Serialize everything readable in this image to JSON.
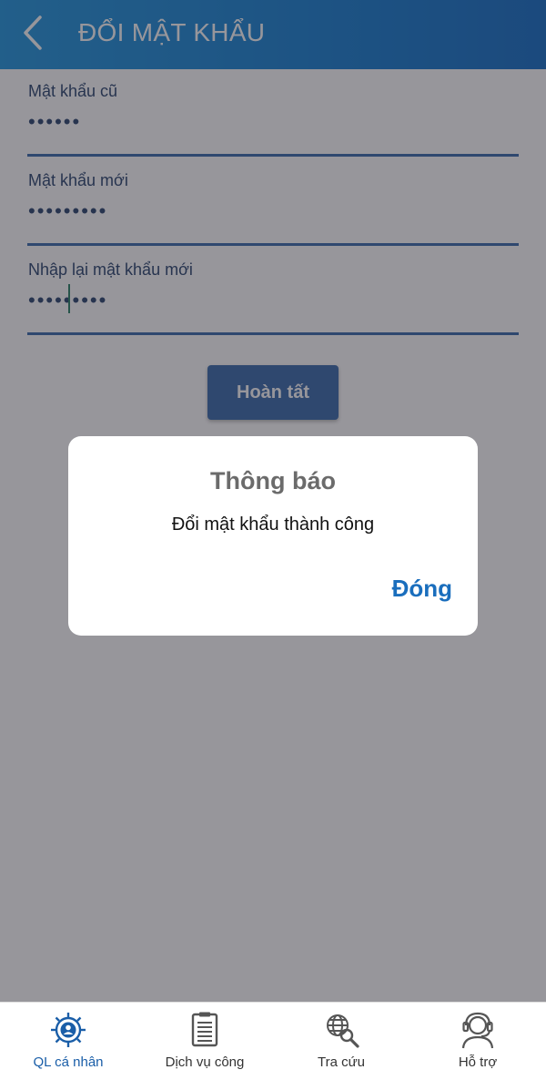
{
  "header": {
    "title": "ĐỔI MẬT KHẨU",
    "back_icon": "chevron-left-icon"
  },
  "form": {
    "old_password": {
      "label": "Mật khẩu cũ",
      "value": "••••••"
    },
    "new_password": {
      "label": "Mật khẩu mới",
      "value": "•••••••••"
    },
    "confirm_password": {
      "label": "Nhập lại mật khẩu mới",
      "value": "•••••••••"
    },
    "submit_label": "Hoàn tất"
  },
  "dialog": {
    "title": "Thông báo",
    "message": "Đổi mật khẩu thành công",
    "close_label": "Đóng"
  },
  "bottom_nav": {
    "items": [
      {
        "label": "QL cá nhân",
        "icon": "user-gear-icon",
        "active": true
      },
      {
        "label": "Dịch vụ công",
        "icon": "clipboard-icon",
        "active": false
      },
      {
        "label": "Tra cứu",
        "icon": "globe-search-icon",
        "active": false
      },
      {
        "label": "Hỗ trợ",
        "icon": "support-headset-icon",
        "active": false
      }
    ]
  },
  "colors": {
    "header_blue": "#0a78cf",
    "primary": "#2f62a6",
    "accent_link": "#1a6ebd",
    "overlay": "#302d37"
  }
}
